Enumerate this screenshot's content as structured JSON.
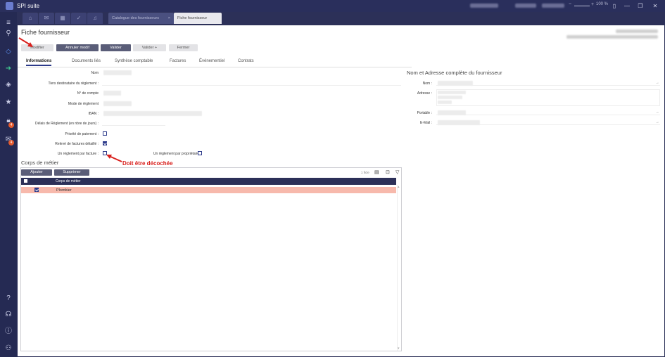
{
  "app": {
    "title": "SPI suite",
    "zoom": "100 %"
  },
  "tabs": {
    "catalogue": "Catalogue des fournisseurs",
    "fiche": "Fiche fournisseur",
    "close": "×"
  },
  "window": {
    "minimize": "—",
    "restore": "❐",
    "close": "✕"
  },
  "sidebar": {
    "badge1": "4",
    "badge2": "4"
  },
  "page": {
    "title": "Fiche fournisseur"
  },
  "toolbar": {
    "modifier": "Modifier",
    "annuler": "Annuler modif",
    "valider": "Valider",
    "valider_plus": "Valider +",
    "fermer": "Fermer"
  },
  "subtabs": [
    "Informations",
    "Documents liés",
    "Synthèse comptable",
    "Factures",
    "Événementiel",
    "Contrats"
  ],
  "form": {
    "nom": "Nom",
    "tiers": "Tiers destinataire du règlement :",
    "compte": "N° de compte",
    "mode": "Mode de règlement",
    "iban": "IBAN :",
    "delais": "Délais de Règlement (en nbre de jours) :",
    "priorite": "Priorité de paiement :",
    "releve": "Relevé de factures détaillé :",
    "reglement_facture": "Un règlement par facture :",
    "reglement_proprietaire": "Un règlement par propriétaire :"
  },
  "checkboxes": {
    "priorite": false,
    "releve": true,
    "reglement_facture": false,
    "reglement_proprietaire": false
  },
  "annotation": "Doit être décochée",
  "right": {
    "title": "Nom et Adresse complète du fournisseur",
    "nom": "Nom :",
    "adresse": "Adresse :",
    "portable": "Portable :",
    "email": "E-Mail :",
    "arrow": "→"
  },
  "corps": {
    "title": "Corps de métier",
    "ajouter": "Ajouter",
    "supprimer": "Supprimer",
    "count": "1 ficle",
    "col": "Corps de métier",
    "rows": [
      {
        "label": "Plombier",
        "checked": true
      }
    ]
  },
  "colors": {
    "accent": "#2c3058",
    "highlight": "#f7b9ac",
    "annotation": "#d9201d"
  }
}
